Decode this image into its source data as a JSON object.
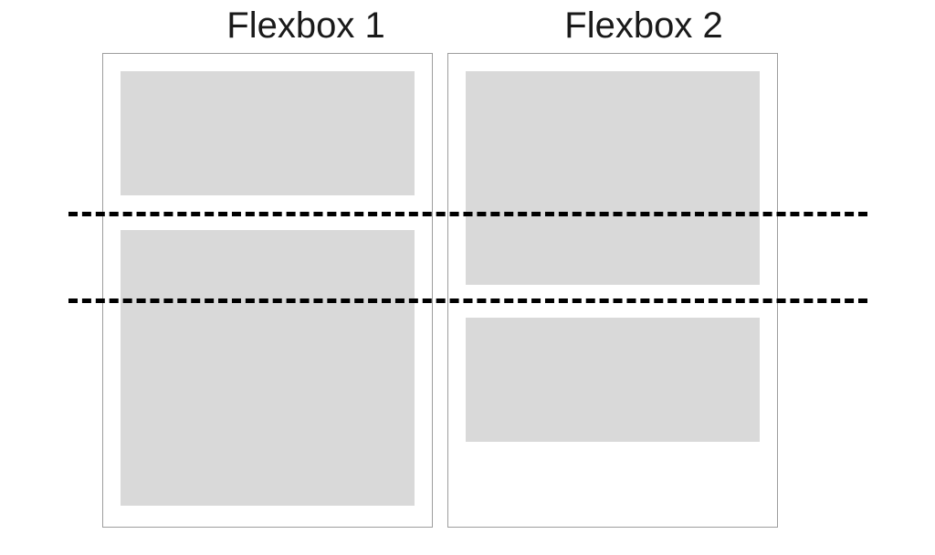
{
  "title_left": "Flexbox 1",
  "title_right": "Flexbox 2"
}
